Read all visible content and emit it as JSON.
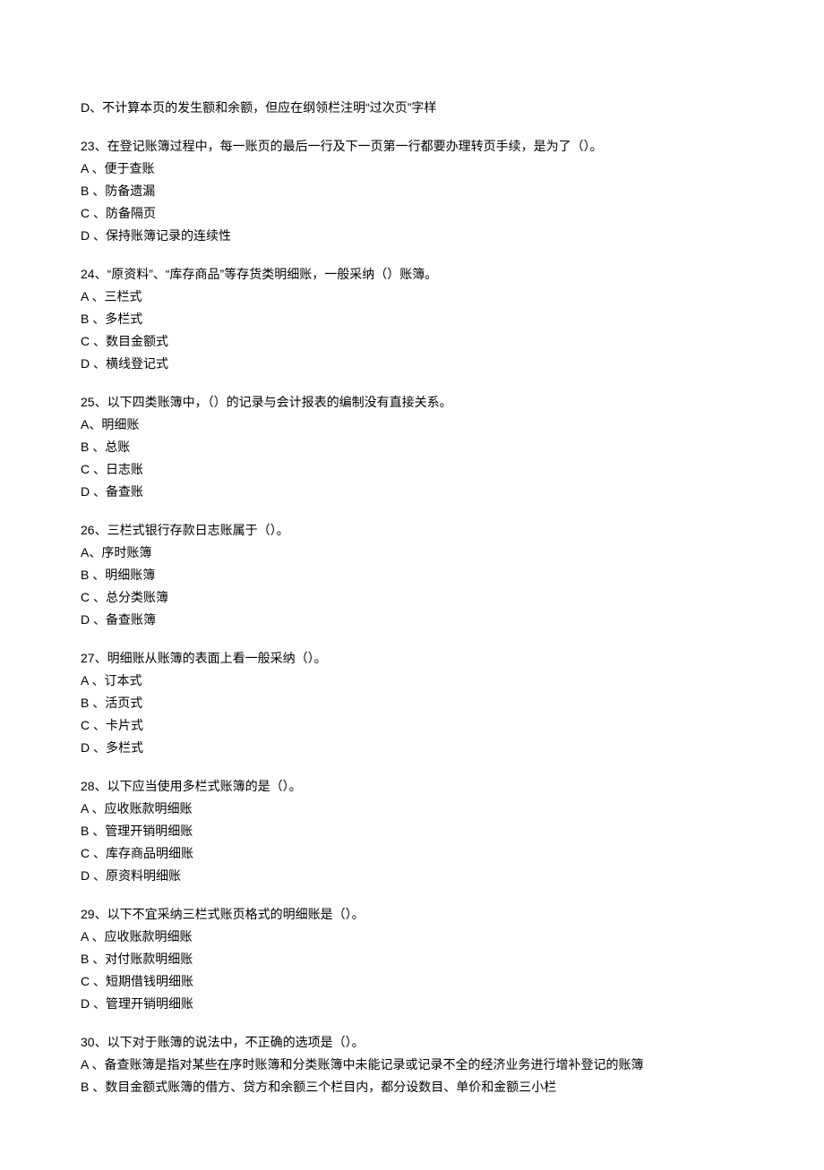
{
  "orphan_option": "D、不计算本页的发生额和余额，但应在纲领栏注明“过次页”字样",
  "questions": [
    {
      "stem": "23、在登记账簿过程中，每一账页的最后一行及下一页第一行都要办理转页手续，是为了（）。",
      "options": [
        "A 、便于查账",
        "B 、防备遗漏",
        "C 、防备隔页",
        "D 、保持账簿记录的连续性"
      ]
    },
    {
      "stem": "24、“原资料”、“库存商品”等存货类明细账，一般采纳（）账簿。",
      "options": [
        "A 、三栏式",
        "B 、多栏式",
        "C 、数目金额式",
        "D 、横线登记式"
      ]
    },
    {
      "stem": "25、以下四类账簿中，（）的记录与会计报表的编制没有直接关系。",
      "options": [
        "A、明细账",
        "B 、总账",
        "C 、日志账",
        "D 、备查账"
      ]
    },
    {
      "stem": "26、三栏式银行存款日志账属于（）。",
      "options": [
        "A、序时账簿",
        "B 、明细账簿",
        "C 、总分类账簿",
        "D 、备查账簿"
      ]
    },
    {
      "stem": "27、明细账从账簿的表面上看一般采纳（）。",
      "options": [
        "A 、订本式",
        "B 、活页式",
        "C 、卡片式",
        "D 、多栏式"
      ]
    },
    {
      "stem": "28、以下应当使用多栏式账簿的是（）。",
      "options": [
        "A 、应收账款明细账",
        "B 、管理开销明细账",
        "C 、库存商品明细账",
        "D 、原资料明细账"
      ]
    },
    {
      "stem": "29、以下不宜采纳三栏式账页格式的明细账是（）。",
      "options": [
        "A 、应收账款明细账",
        "B 、对付账款明细账",
        "C 、短期借钱明细账",
        "D 、管理开销明细账"
      ]
    },
    {
      "stem": "30、以下对于账簿的说法中，不正确的选项是（）。",
      "options": [
        "A 、备查账簿是指对某些在序时账簿和分类账簿中未能记录或记录不全的经济业务进行增补登记的账簿",
        "B 、数目金额式账簿的借方、贷方和余额三个栏目内，都分设数目、单价和金额三小栏"
      ]
    }
  ]
}
